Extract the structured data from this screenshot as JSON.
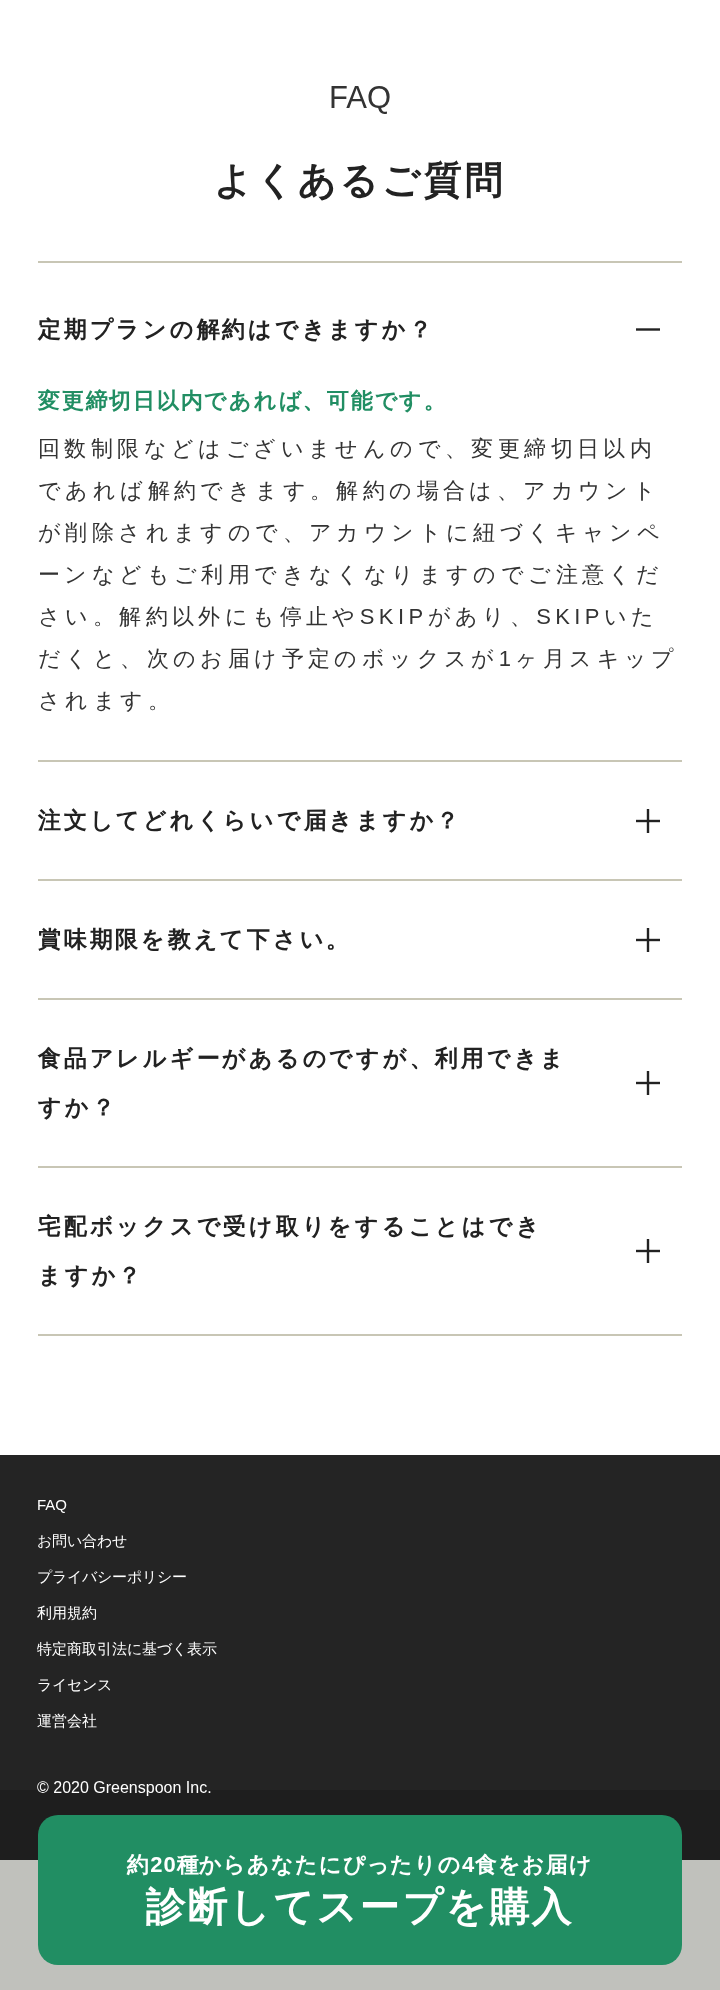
{
  "header": {
    "eyebrow": "FAQ",
    "title": "よくあるご質問"
  },
  "faq": [
    {
      "question": "定期プランの解約はできますか？",
      "expanded": true,
      "answer_title": "変更締切日以内であれば、可能です。",
      "answer_body": "回数制限などはございませんので、変更締切日以内であれば解約できます。解約の場合は、アカウントが削除されますので、アカウントに紐づくキャンペーンなどもご利用できなくなりますのでご注意ください。解約以外にも停止やSKIPがあり、SKIPいただくと、次のお届け予定のボックスが1ヶ月スキップされます。"
    },
    {
      "question": "注文してどれくらいで届きますか？",
      "expanded": false
    },
    {
      "question": "賞味期限を教えて下さい。",
      "expanded": false
    },
    {
      "question": "食品アレルギーがあるのですが、利用できますか？",
      "expanded": false
    },
    {
      "question": "宅配ボックスで受け取りをすることはできますか？",
      "expanded": false
    }
  ],
  "footer": {
    "links": [
      "FAQ",
      "お問い合わせ",
      "プライバシーポリシー",
      "利用規約",
      "特定商取引法に基づく表示",
      "ライセンス",
      "運営会社"
    ],
    "copyright": "© 2020 Greenspoon Inc."
  },
  "cta": {
    "subtitle": "約20種からあなたにぴったりの4食をお届け",
    "label": "診断してスープを購入"
  }
}
